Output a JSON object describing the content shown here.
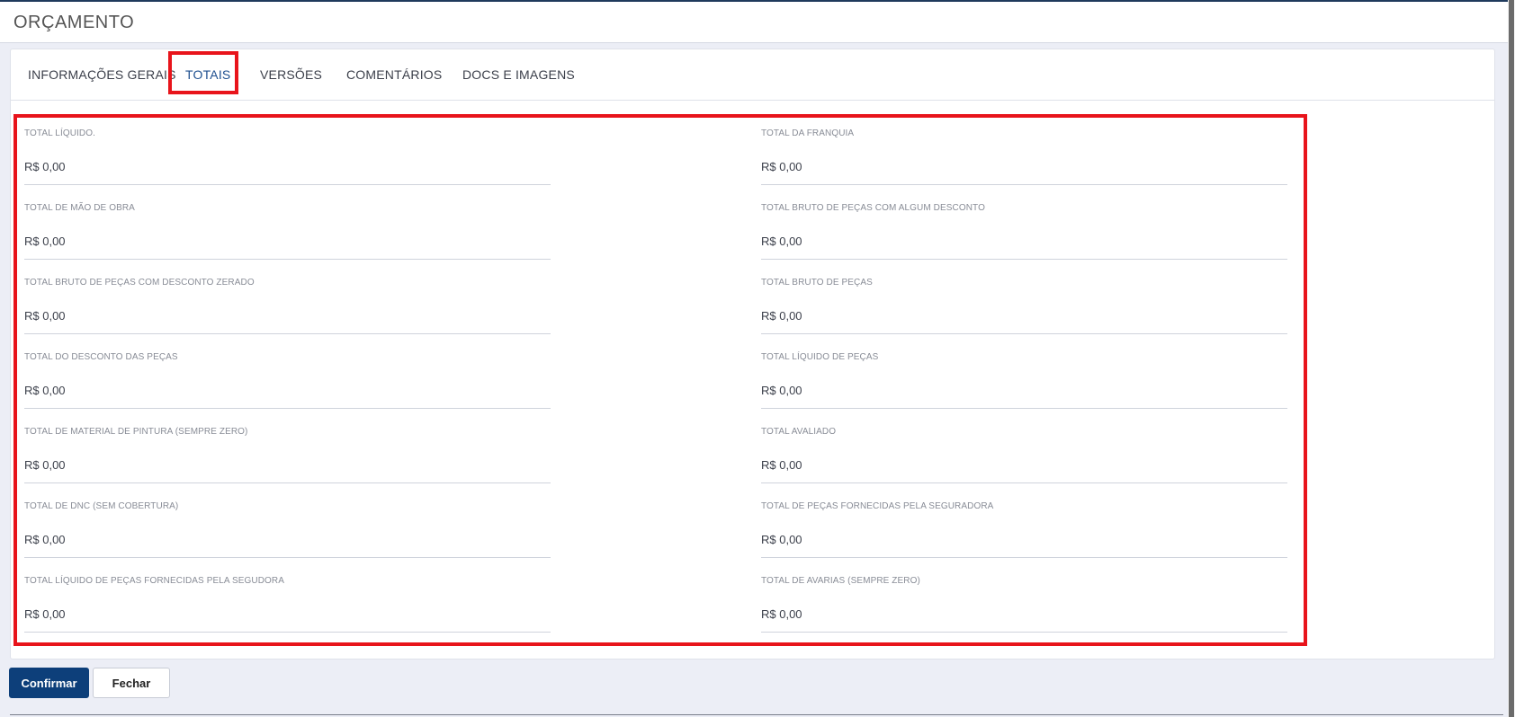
{
  "header": {
    "title": "ORÇAMENTO"
  },
  "tabs": [
    {
      "label": "INFORMAÇÕES GERAIS"
    },
    {
      "label": "TOTAIS",
      "active": true
    },
    {
      "label": "VERSÕES"
    },
    {
      "label": "COMENTÁRIOS"
    },
    {
      "label": "DOCS E IMAGENS"
    }
  ],
  "totals": {
    "left": [
      {
        "label": "TOTAL LÍQUIDO.",
        "value": "R$ 0,00"
      },
      {
        "label": "TOTAL DE MÃO DE OBRA",
        "value": "R$ 0,00"
      },
      {
        "label": "TOTAL BRUTO DE PEÇAS COM DESCONTO ZERADO",
        "value": "R$ 0,00"
      },
      {
        "label": "TOTAL DO DESCONTO DAS PEÇAS",
        "value": "R$ 0,00"
      },
      {
        "label": "TOTAL DE MATERIAL DE PINTURA (SEMPRE ZERO)",
        "value": "R$ 0,00"
      },
      {
        "label": "TOTAL DE DNC (SEM COBERTURA)",
        "value": "R$ 0,00"
      },
      {
        "label": "TOTAL LÍQUIDO DE PEÇAS FORNECIDAS PELA SEGUDORA",
        "value": "R$ 0,00"
      }
    ],
    "right": [
      {
        "label": "TOTAL DA FRANQUIA",
        "value": "R$ 0,00"
      },
      {
        "label": "TOTAL BRUTO DE PEÇAS COM ALGUM DESCONTO",
        "value": "R$ 0,00"
      },
      {
        "label": "TOTAL BRUTO DE PEÇAS",
        "value": "R$ 0,00"
      },
      {
        "label": "TOTAL LÍQUIDO DE PEÇAS",
        "value": "R$ 0,00"
      },
      {
        "label": "TOTAL AVALIADO",
        "value": "R$ 0,00"
      },
      {
        "label": "TOTAL DE PEÇAS FORNECIDAS PELA SEGURADORA",
        "value": "R$ 0,00"
      },
      {
        "label": "TOTAL DE AVARIAS (SEMPRE ZERO)",
        "value": "R$ 0,00"
      }
    ]
  },
  "actions": {
    "confirm_label": "Confirmar",
    "close_label": "Fechar"
  },
  "colors": {
    "primary": "#0d3f7a",
    "highlight": "#e8141b",
    "active_tab": "#1e4f8f"
  }
}
